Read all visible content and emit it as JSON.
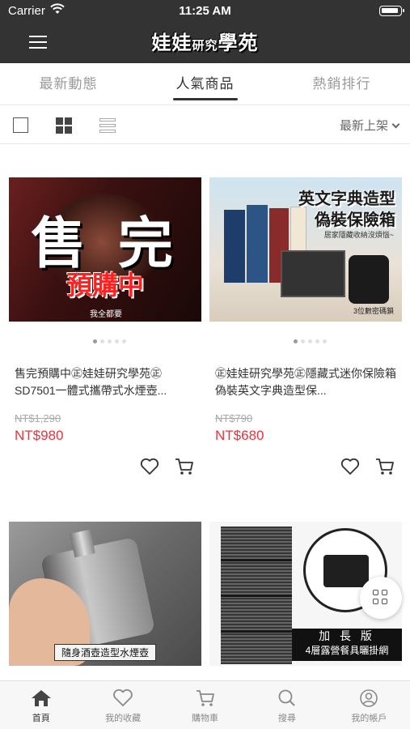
{
  "status_bar": {
    "carrier": "Carrier",
    "time": "11:25 AM"
  },
  "header": {
    "logo_main": "娃娃",
    "logo_small": "研究",
    "logo_end": "學苑"
  },
  "tabs": [
    {
      "label": "最新動態",
      "active": false
    },
    {
      "label": "人氣商品",
      "active": true
    },
    {
      "label": "熱銷排行",
      "active": false
    }
  ],
  "view_bar": {
    "sort_label": "最新上架",
    "selected_view": "grid"
  },
  "products": [
    {
      "image_text": {
        "main": "售 完",
        "sub": "預購中",
        "small": "我全都要"
      },
      "name": "售完預購中㊣娃娃研究學苑㊣SD7501一體式攜帶式水煙壺...",
      "original_price": "NT$1,290",
      "price": "NT$980"
    },
    {
      "image_text": {
        "line1": "英文字典造型",
        "line2": "偽裝保險箱",
        "line3": "居家隱藏收納沒煩惱~",
        "line4": "3位數密碼鎖"
      },
      "name": "㊣娃娃研究學苑㊣隱藏式迷你保險箱 偽裝英文字典造型保...",
      "original_price": "NT$790",
      "price": "NT$680"
    },
    {
      "image_text": {
        "caption": "隨身酒壺造型水煙壺"
      }
    },
    {
      "image_text": {
        "line1": "加 長 版",
        "line2": "4層露營餐具曬掛網"
      }
    }
  ],
  "bottom_nav": [
    {
      "label": "首頁",
      "icon": "home-icon",
      "active": true
    },
    {
      "label": "我的收藏",
      "icon": "heart-icon",
      "active": false
    },
    {
      "label": "購物車",
      "icon": "cart-icon",
      "active": false
    },
    {
      "label": "搜尋",
      "icon": "search-icon",
      "active": false
    },
    {
      "label": "我的帳戶",
      "icon": "user-icon",
      "active": false
    }
  ],
  "colors": {
    "header_bg": "#333333",
    "price_red": "#e8343f",
    "inactive_gray": "#9a9a9a"
  }
}
